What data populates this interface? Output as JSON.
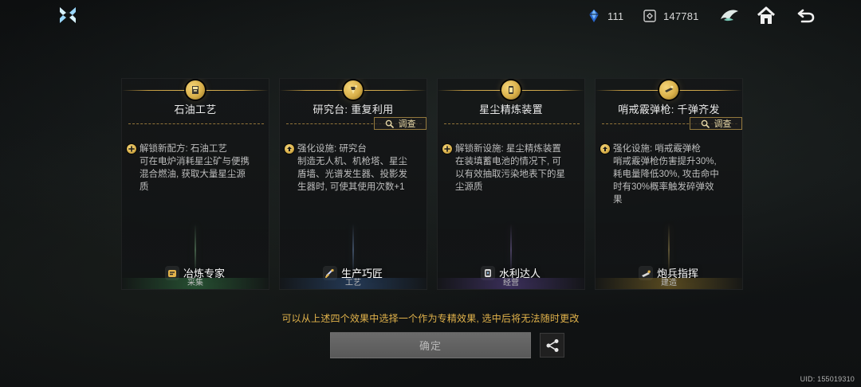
{
  "topbar": {
    "resource_1_value": "111",
    "resource_2_value": "147781"
  },
  "cards": [
    {
      "title": "石油工艺",
      "has_inspect": false,
      "desc_head": "解锁新配方: 石油工艺",
      "desc_body": "可在电炉消耗星尘矿与便携\n混合燃油, 获取大量星尘源\n质",
      "role_label": "冶炼专家",
      "category": "采集"
    },
    {
      "title": "研究台: 重复利用",
      "has_inspect": true,
      "inspect_label": "调查",
      "desc_head": "强化设施: 研究台",
      "desc_body": "制造无人机、机枪塔、星尘\n盾墙、光谱发生器、投影发\n生器时, 可使其使用次数+1",
      "role_label": "生产巧匠",
      "category": "工艺"
    },
    {
      "title": "星尘精炼装置",
      "has_inspect": false,
      "desc_head": "解锁新设施: 星尘精炼装置",
      "desc_body": "在装填蓄电池的情况下, 可\n以有效抽取污染地表下的星\n尘源质",
      "role_label": "水利达人",
      "category": "经营"
    },
    {
      "title": "哨戒霰弹枪: 千弹齐发",
      "has_inspect": true,
      "inspect_label": "调查",
      "desc_head": "强化设施: 哨戒霰弹枪",
      "desc_body": "哨戒霰弹枪伤害提升30%,\n耗电量降低30%, 攻击命中\n时有30%概率触发碎弹效\n果",
      "role_label": "炮兵指挥",
      "category": "建造"
    }
  ],
  "footer": {
    "hint": "可以从上述四个效果中选择一个作为专精效果, 选中后将无法随时更改",
    "confirm_label": "确定",
    "uid": "UID: 155019310"
  },
  "colors": {
    "accent_gold": "#e2b34b",
    "hint_gold": "#e2b34b"
  },
  "icons": {
    "logo": "game-logo-icon",
    "resource_1": "blue-crystal-icon",
    "resource_2": "currency-icon",
    "emblem": "emblem-icon",
    "home": "home-icon",
    "back": "back-arrow-icon",
    "share": "share-icon"
  }
}
